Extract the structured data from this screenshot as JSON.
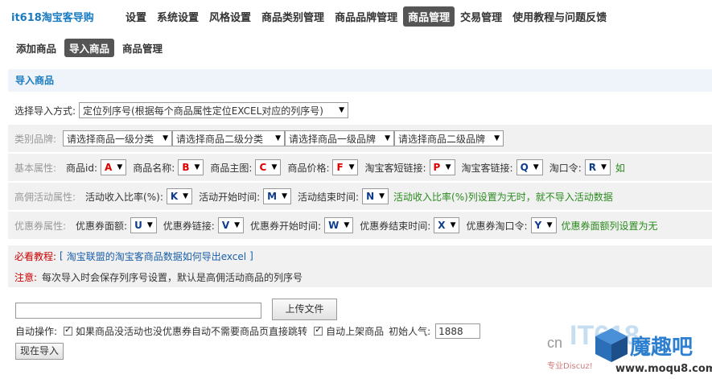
{
  "brand": "it618淘宝客导购",
  "nav": [
    {
      "label": "设置"
    },
    {
      "label": "系统设置"
    },
    {
      "label": "风格设置"
    },
    {
      "label": "商品类别管理"
    },
    {
      "label": "商品品牌管理"
    },
    {
      "label": "商品管理",
      "active": true
    },
    {
      "label": "交易管理"
    },
    {
      "label": "使用教程与问题反馈"
    }
  ],
  "subnav": [
    {
      "label": "添加商品"
    },
    {
      "label": "导入商品",
      "active": true
    },
    {
      "label": "商品管理"
    }
  ],
  "section_title": "导入商品",
  "import_mode": {
    "label": "选择导入方式:",
    "value": "定位列序号(根据每个商品属性定位EXCEL对应的列序号)"
  },
  "category": {
    "label": "类别品牌:",
    "selects": [
      "请选择商品一级分类",
      "请选择商品二级分类",
      "请选择商品一级品牌",
      "请选择商品二级品牌"
    ]
  },
  "basic": {
    "label": "基本属性:",
    "fields": [
      {
        "name": "商品id:",
        "code": "A",
        "color": "red"
      },
      {
        "name": "商品名称:",
        "code": "B",
        "color": "red"
      },
      {
        "name": "商品主图:",
        "code": "C",
        "color": "red"
      },
      {
        "name": "商品价格:",
        "code": "F",
        "color": "red"
      },
      {
        "name": "淘宝客短链接:",
        "code": "P",
        "color": "red"
      },
      {
        "name": "淘宝客链接:",
        "code": "Q",
        "color": "blue"
      },
      {
        "name": "淘口令:",
        "code": "R",
        "color": "blue"
      }
    ],
    "note": "如"
  },
  "activity": {
    "label": "高佣活动属性:",
    "fields": [
      {
        "name": "活动收入比率(%):",
        "code": "K",
        "color": "blue"
      },
      {
        "name": "活动开始时间:",
        "code": "M",
        "color": "blue"
      },
      {
        "name": "活动结束时间:",
        "code": "N",
        "color": "blue"
      }
    ],
    "note": "活动收入比率(%)列设置为无时，就不导入活动数据"
  },
  "coupon": {
    "label": "优惠券属性:",
    "fields": [
      {
        "name": "优惠券面额:",
        "code": "U",
        "color": "blue"
      },
      {
        "name": "优惠券链接:",
        "code": "V",
        "color": "blue"
      },
      {
        "name": "优惠券开始时间:",
        "code": "W",
        "color": "blue"
      },
      {
        "name": "优惠券结束时间:",
        "code": "X",
        "color": "blue"
      },
      {
        "name": "优惠券淘口令:",
        "code": "Y",
        "color": "blue"
      }
    ],
    "note": "优惠券面额列设置为无"
  },
  "tutorial": {
    "label": "必看教程:",
    "bracket_open": "[",
    "link": "淘宝联盟的淘宝客商品数据如何导出excel",
    "bracket_close": "]"
  },
  "notice": {
    "label": "注意:",
    "text": "每次导入时会保存列序号设置，默认是高佣活动商品的列序号"
  },
  "upload": {
    "button": "上传文件"
  },
  "auto": {
    "label": "自动操作:",
    "option1": "如果商品没活动也没优惠券自动不需要商品页直接跳转",
    "option2": "自动上架商品",
    "popularity_label": "初始人气:",
    "popularity_value": "1888"
  },
  "import_button": "现在导入",
  "watermark": {
    "logo_text": "IT618",
    "prefix": "cn",
    "site_name": "魔趣吧",
    "slogan": "专业Discuz!",
    "url": "www.moqu8.com"
  },
  "colors": {
    "accent": "#1a7bc0",
    "code_red": "#d00000",
    "code_blue": "#0d3c8c",
    "note_green": "#2a8a1e"
  }
}
